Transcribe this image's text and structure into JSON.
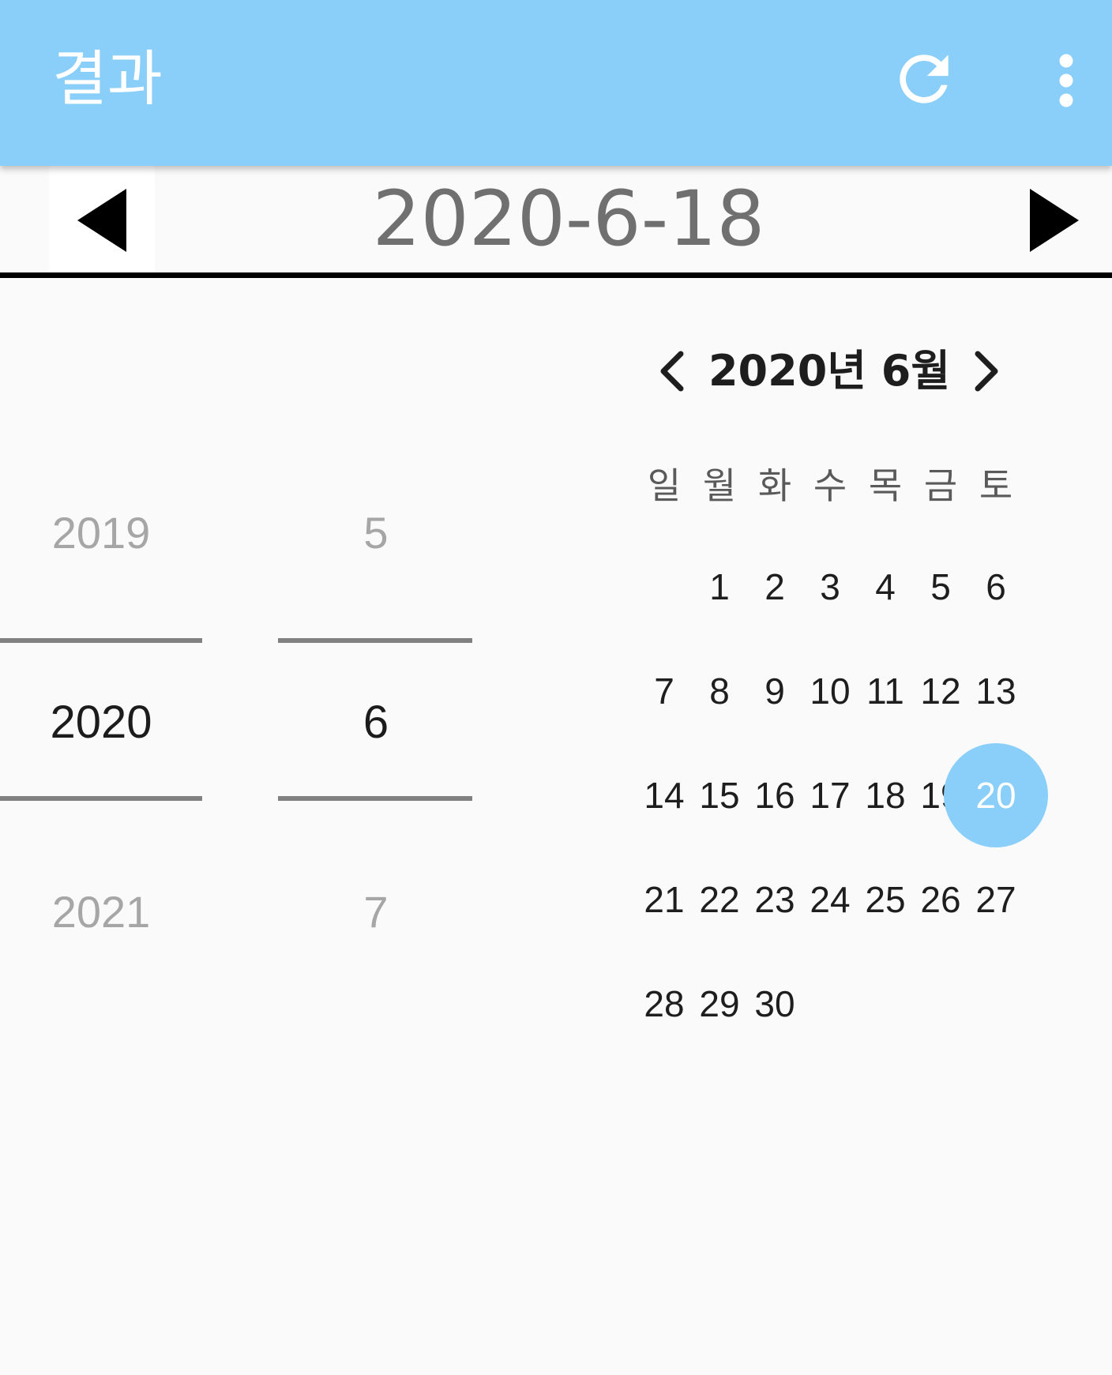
{
  "appbar": {
    "title": "결과",
    "refresh_icon": "refresh-icon",
    "more_icon": "more-vert-icon",
    "background_color": "#8acefa"
  },
  "date_navigator": {
    "date": "2020-6-18",
    "prev_icon": "triangle-left-icon",
    "next_icon": "triangle-right-icon"
  },
  "year_picker": {
    "previous": "2019",
    "selected": "2020",
    "next": "2021"
  },
  "month_picker": {
    "previous": "5",
    "selected": "6",
    "next": "7"
  },
  "calendar": {
    "title": "2020년 6월",
    "prev_icon": "chevron-left-icon",
    "next_icon": "chevron-right-icon",
    "weekdays": [
      "일",
      "월",
      "화",
      "수",
      "목",
      "금",
      "토"
    ],
    "leading_blank_days": 1,
    "days": [
      "1",
      "2",
      "3",
      "4",
      "5",
      "6",
      "7",
      "8",
      "9",
      "10",
      "11",
      "12",
      "13",
      "14",
      "15",
      "16",
      "17",
      "18",
      "19",
      "20",
      "21",
      "22",
      "23",
      "24",
      "25",
      "26",
      "27",
      "28",
      "29",
      "30"
    ],
    "selected_day": "20",
    "selected_color": "#8acefa"
  }
}
